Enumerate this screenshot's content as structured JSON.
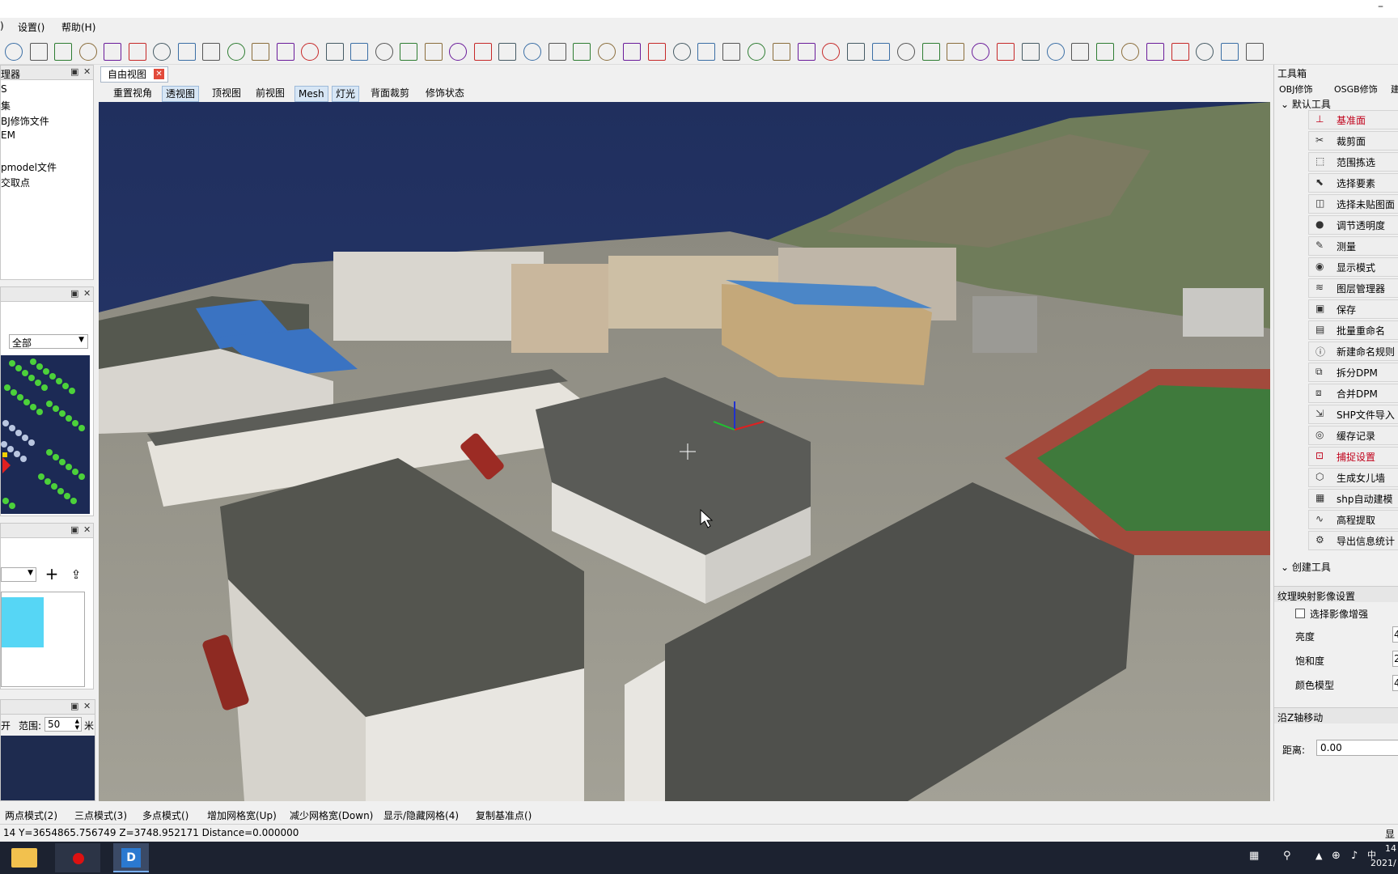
{
  "window": {
    "minimize_glyph": "–"
  },
  "menu": {
    "items": [
      "设置()",
      "帮助(H)"
    ],
    "edge_fragment": ")"
  },
  "left": {
    "panel1": {
      "title": "理器",
      "tree": [
        "S",
        "集",
        "BJ修饰文件",
        "EM",
        "pmodel文件",
        "交取点"
      ]
    },
    "panel2": {
      "filter_value": "全部"
    },
    "panel4": {
      "open_label": "开",
      "range_label": "范围:",
      "range_value": "50",
      "unit": "米"
    }
  },
  "viewtabs": {
    "active_tab": "自由视图"
  },
  "viewbuttons": [
    "重置视角",
    "透视图",
    "顶视图",
    "前视图",
    "Mesh",
    "灯光",
    "背面裁剪",
    "修饰状态"
  ],
  "toolbox": {
    "title": "工具箱",
    "tabs": [
      "OBJ修饰",
      "OSGB修饰",
      "建"
    ],
    "group_default": "默认工具",
    "items": [
      {
        "label": "基准面",
        "icon": "datum-plane-icon",
        "highlight": true
      },
      {
        "label": "裁剪面",
        "icon": "scissors-icon",
        "highlight": false
      },
      {
        "label": "范围拣选",
        "icon": "range-select-icon",
        "highlight": false
      },
      {
        "label": "选择要素",
        "icon": "select-feature-icon",
        "highlight": false
      },
      {
        "label": "选择未贴图面",
        "icon": "select-untextured-icon",
        "highlight": false
      },
      {
        "label": "调节透明度",
        "icon": "transparency-icon",
        "highlight": false
      },
      {
        "label": "测量",
        "icon": "ruler-icon",
        "highlight": false
      },
      {
        "label": "显示模式",
        "icon": "eye-icon",
        "highlight": false
      },
      {
        "label": "图层管理器",
        "icon": "layers-icon",
        "highlight": false
      },
      {
        "label": "保存",
        "icon": "save-icon",
        "highlight": false
      },
      {
        "label": "批量重命名",
        "icon": "batch-rename-icon",
        "highlight": false
      },
      {
        "label": "新建命名规则",
        "icon": "info-icon",
        "highlight": false
      },
      {
        "label": "拆分DPM",
        "icon": "split-icon",
        "highlight": false
      },
      {
        "label": "合并DPM",
        "icon": "merge-icon",
        "highlight": false
      },
      {
        "label": "SHP文件导入",
        "icon": "shp-import-icon",
        "highlight": false
      },
      {
        "label": "缓存记录",
        "icon": "cache-icon",
        "highlight": false
      },
      {
        "label": "捕捉设置",
        "icon": "snap-settings-icon",
        "highlight": true
      },
      {
        "label": "生成女儿墙",
        "icon": "parapet-icon",
        "highlight": false
      },
      {
        "label": "shp自动建模",
        "icon": "auto-model-icon",
        "highlight": false
      },
      {
        "label": "高程提取",
        "icon": "elevation-icon",
        "highlight": false
      },
      {
        "label": "导出信息统计",
        "icon": "export-stats-icon",
        "highlight": false
      }
    ],
    "group_create": "创建工具"
  },
  "texture": {
    "title": "纹理映射影像设置",
    "enhance_label": "选择影像增强",
    "brightness_label": "亮度",
    "brightness_value": "4",
    "saturation_label": "饱和度",
    "saturation_value": "2",
    "colormodel_label": "颜色模型",
    "colormodel_value": "4"
  },
  "zmove": {
    "title": "沿Z轴移动",
    "distance_label": "距离:",
    "distance_value": "0.00"
  },
  "bottom": {
    "items": [
      "两点模式(2)",
      "三点模式(3)",
      "多点模式()",
      "增加网格宽(Up)",
      "减少网格宽(Down)",
      "显示/隐藏网格(4)",
      "复制基准点()"
    ]
  },
  "status": {
    "coords": "14  Y=3654865.756749  Z=3748.952171  Distance=0.000000",
    "right_fragment": "显"
  },
  "taskbar": {
    "time": "14",
    "date": "2021/"
  },
  "colors": {
    "accent_blue": "#3a6ea5",
    "highlight_red": "#c0001a",
    "sky": "#243361"
  }
}
